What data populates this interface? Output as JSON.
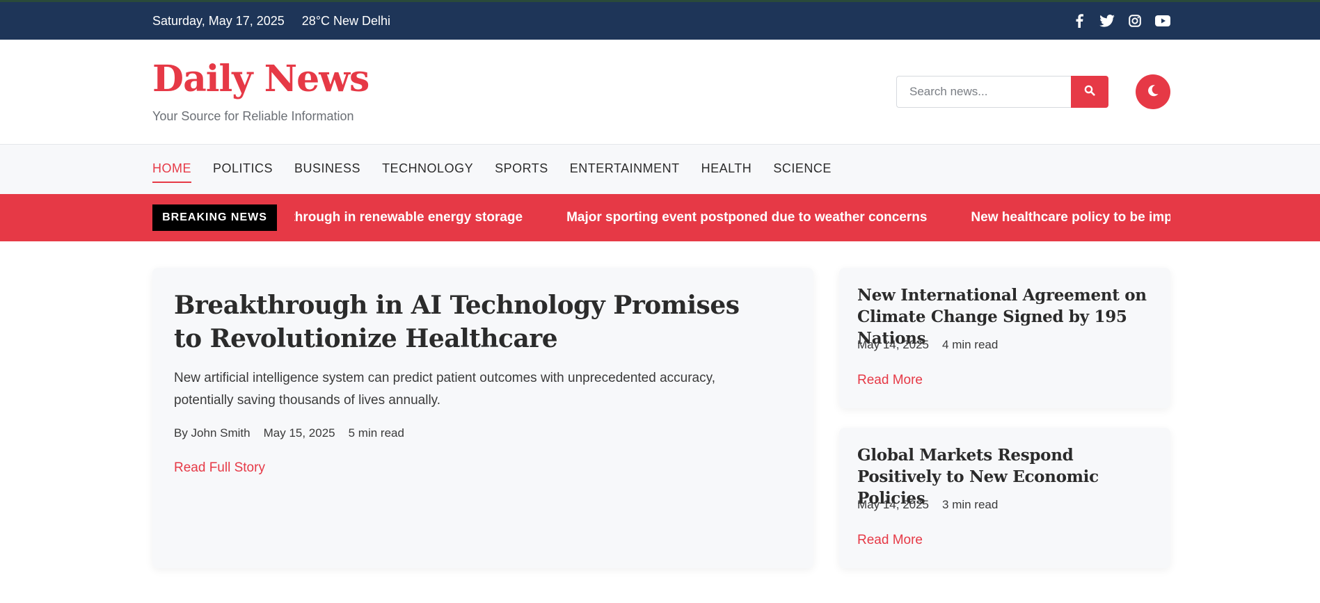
{
  "topbar": {
    "date": "Saturday, May 17, 2025",
    "weather": "28°C New Delhi",
    "social": [
      "facebook-icon",
      "twitter-icon",
      "instagram-icon",
      "youtube-icon"
    ]
  },
  "header": {
    "logo": "Daily News",
    "tagline": "Your Source for Reliable Information",
    "search_placeholder": "Search news...",
    "search_icon": "search-icon",
    "mode_icon": "moon-icon"
  },
  "nav": {
    "items": [
      "HOME",
      "POLITICS",
      "BUSINESS",
      "TECHNOLOGY",
      "SPORTS",
      "ENTERTAINMENT",
      "HEALTH",
      "SCIENCE"
    ],
    "active": "HOME"
  },
  "breaking": {
    "label": "BREAKING NEWS",
    "items": [
      "Scientific breakthrough in renewable energy storage",
      "Major sporting event postponed due to weather concerns",
      "New healthcare policy to be implemented"
    ]
  },
  "featured": {
    "title": "Breakthrough in AI Technology Promises to Revolutionize Healthcare",
    "excerpt": "New artificial intelligence system can predict patient outcomes with unprecedented accuracy, potentially saving thousands of lives annually.",
    "author": "By John Smith",
    "date": "May 15, 2025",
    "read_time": "5 min read",
    "cta": "Read Full Story"
  },
  "side": [
    {
      "title": "New International Agreement on Climate Change Signed by 195 Nations",
      "date": "May 14, 2025",
      "read_time": "4 min read",
      "cta": "Read More"
    },
    {
      "title": "Global Markets Respond Positively to New Economic Policies",
      "date": "May 14, 2025",
      "read_time": "3 min read",
      "cta": "Read More"
    }
  ],
  "colors": {
    "accent": "#e63946",
    "topbar": "#1e3558",
    "nav_bg": "#f7f8fa"
  }
}
